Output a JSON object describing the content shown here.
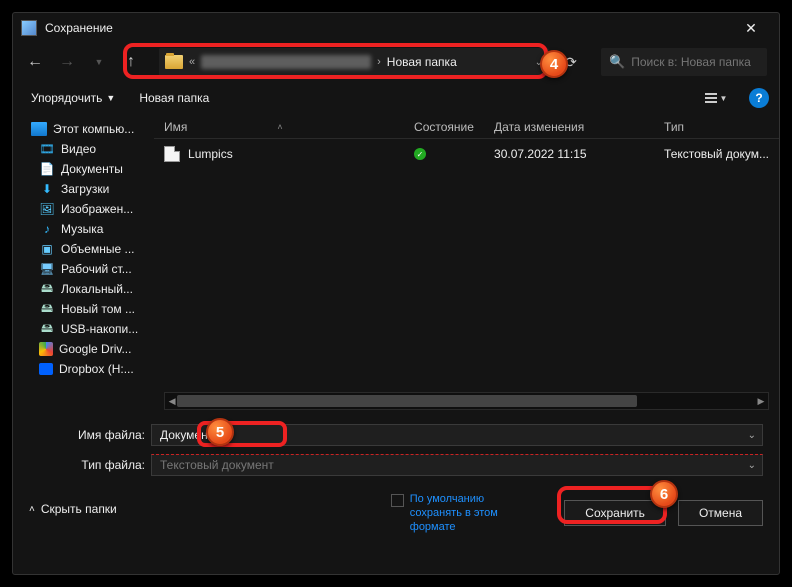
{
  "title": "Сохранение",
  "nav": {
    "segment": "Новая папка"
  },
  "search": {
    "placeholder": "Поиск в: Новая папка"
  },
  "toolbar": {
    "organize": "Упорядочить",
    "newfolder": "Новая папка"
  },
  "sidebar": {
    "items": [
      {
        "label": "Этот компью..."
      },
      {
        "label": "Видео"
      },
      {
        "label": "Документы"
      },
      {
        "label": "Загрузки"
      },
      {
        "label": "Изображен..."
      },
      {
        "label": "Музыка"
      },
      {
        "label": "Объемные ..."
      },
      {
        "label": "Рабочий ст..."
      },
      {
        "label": "Локальный..."
      },
      {
        "label": "Новый том ..."
      },
      {
        "label": "USB-накопи..."
      },
      {
        "label": "Google Driv..."
      },
      {
        "label": "Dropbox (H:..."
      }
    ]
  },
  "columns": {
    "name": "Имя",
    "state": "Состояние",
    "date": "Дата изменения",
    "type": "Тип"
  },
  "files": [
    {
      "name": "Lumpics",
      "state": "✓",
      "date": "30.07.2022 11:15",
      "type": "Текстовый докум..."
    }
  ],
  "form": {
    "filename_label": "Имя файла:",
    "filename_value": "Документ",
    "filetype_label": "Тип файла:",
    "filetype_value": "Текстовый документ"
  },
  "default_text": "По умолчанию сохранять в этом формате",
  "hide_folders": "Скрыть папки",
  "buttons": {
    "save": "Сохранить",
    "cancel": "Отмена"
  },
  "callouts": {
    "c4": "4",
    "c5": "5",
    "c6": "6"
  }
}
